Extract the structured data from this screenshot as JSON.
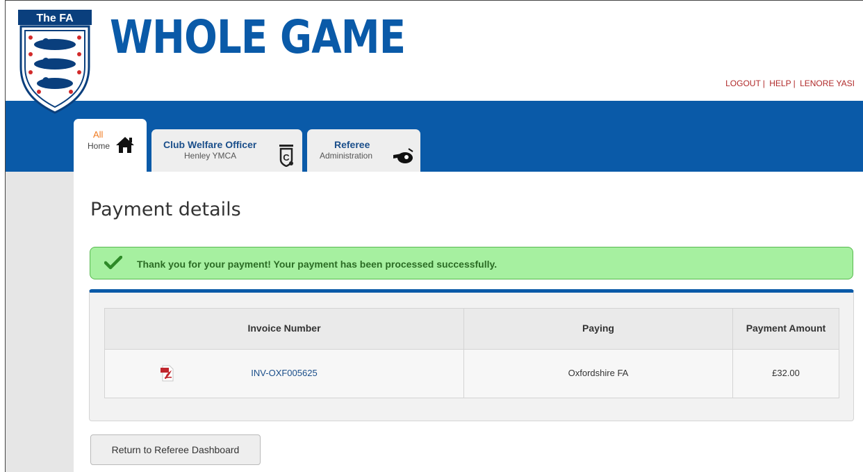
{
  "header": {
    "logo_label": "The FA",
    "brand_title": "WHOLE GAME",
    "user_links": [
      {
        "label": "LOGOUT"
      },
      {
        "label": "HELP"
      },
      {
        "label": "LENORE YASI"
      }
    ],
    "separator": "|"
  },
  "tabs": [
    {
      "line1": "All",
      "line2": "Home",
      "icon": "home-icon"
    },
    {
      "line1": "Club Welfare Officer",
      "line2": "Henley YMCA",
      "icon": "badge-icon"
    },
    {
      "line1": "Referee",
      "line2": "Administration",
      "icon": "whistle-icon"
    }
  ],
  "main": {
    "title": "Payment details",
    "alert": {
      "icon": "check-icon",
      "message": "Thank you for your payment! Your payment has been processed successfully."
    },
    "table": {
      "headers": [
        "Invoice Number",
        "Paying",
        "Payment Amount"
      ],
      "rows": [
        {
          "invoice": "INV-OXF005625",
          "paying": "Oxfordshire FA",
          "amount": "£32.00",
          "icon": "pdf-icon"
        }
      ]
    },
    "return_button": "Return to Referee Dashboard"
  },
  "colors": {
    "brand_blue": "#0a5aa8",
    "success_bg": "#a6f0a0",
    "success_text": "#2b6b24",
    "link_red": "#b02a2a",
    "home_orange": "#f07a1e"
  }
}
